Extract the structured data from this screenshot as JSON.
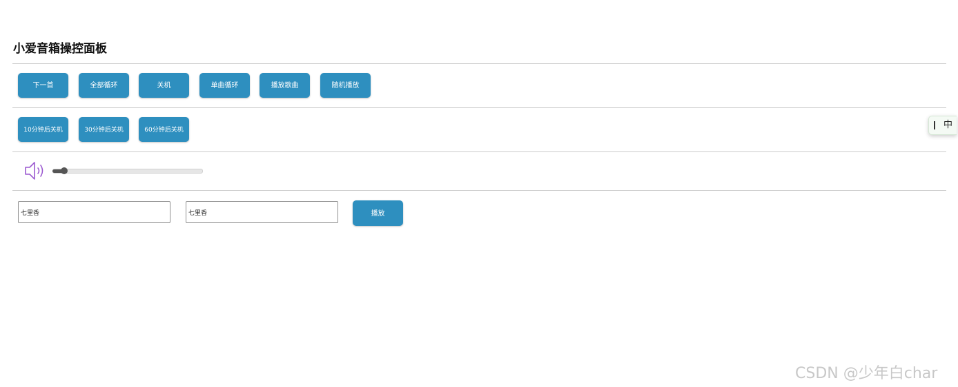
{
  "panel": {
    "title": "小爱音箱操控面板",
    "row1_buttons": [
      {
        "label": "下一首"
      },
      {
        "label": "全部循环"
      },
      {
        "label": "关机"
      },
      {
        "label": "单曲循环"
      },
      {
        "label": "播放歌曲"
      },
      {
        "label": "随机播放"
      }
    ],
    "row2_buttons": [
      {
        "label": "10分钟后关机"
      },
      {
        "label": "30分钟后关机"
      },
      {
        "label": "60分钟后关机"
      }
    ],
    "volume": {
      "icon": "speaker-icon",
      "level": 0.08
    },
    "song_input_1": {
      "value": "七里香"
    },
    "song_input_2": {
      "value": "七里香"
    },
    "play_button": {
      "label": "播放"
    }
  },
  "ime_indicator": {
    "char": "中"
  },
  "watermark": {
    "text": "CSDN @少年白char"
  },
  "colors": {
    "button_bg": "#2e8fbf",
    "button_text": "#ffffff",
    "icon_purple": "#9b59d0"
  }
}
